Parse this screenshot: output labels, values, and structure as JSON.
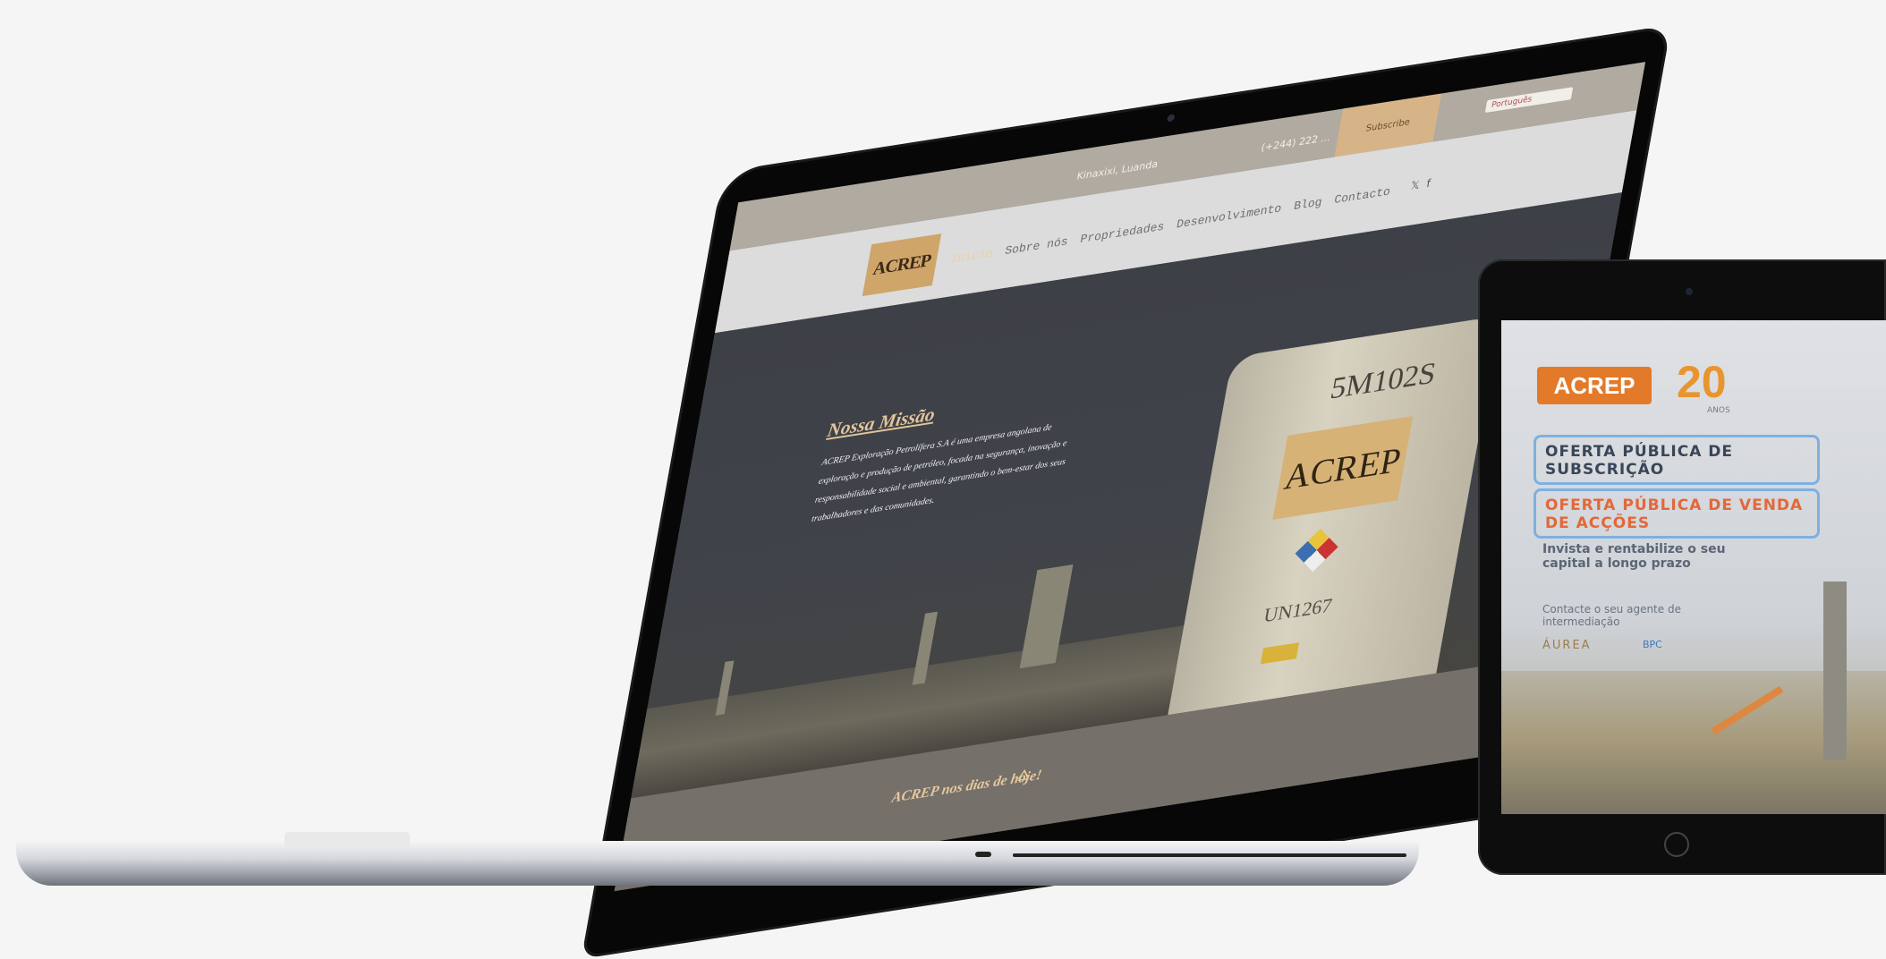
{
  "laptop": {
    "topbar": {
      "address": "Kinaxixi, Luanda",
      "phone": "(+244) 222 ...",
      "cta": "Subscribe",
      "language": "Português"
    },
    "logo_text": "ACREP",
    "nav": [
      {
        "label": "Início"
      },
      {
        "label": "Sobre nós"
      },
      {
        "label": "Propriedades"
      },
      {
        "label": "Desenvolvimento"
      },
      {
        "label": "Blog"
      },
      {
        "label": "Contacto"
      }
    ],
    "social_icons": [
      "twitter-icon",
      "facebook-icon"
    ],
    "hero": {
      "title": "Nossa Missão",
      "text": "ACREP Exploração Petrolífera S.A é uma empresa angolana de exploração e produção de petróleo, focada na segurança, inovação e responsabilidade social e ambiental, garantindo o bem-estar dos seus trabalhadores e das comunidades.",
      "tank_code": "5M102S",
      "tank_logo": "ACREP",
      "tank_un": "UN1267"
    },
    "footer": {
      "text": "ACREP nos dias de hoje!",
      "icon": "oil-rig-icon"
    }
  },
  "tablet": {
    "logo_text": "ACREP",
    "anniversary_number": "20",
    "anniversary_label": "ANOS",
    "offer_subscription": "OFERTA PÚBLICA DE SUBSCRIÇÃO",
    "offer_sale": "OFERTA PÚBLICA DE VENDA DE ACÇÕES",
    "tagline": "Invista e rentabilize o seu capital a longo prazo",
    "contact": "Contacte o seu agente de intermediação",
    "partner_1": "ÁUREA",
    "partner_2": "BPC"
  },
  "colors": {
    "page_background": "#f5f5f5",
    "brand_gold": "#cfa56a",
    "brand_orange": "#e37a2a",
    "offer_blue": "#7fb0e0"
  }
}
